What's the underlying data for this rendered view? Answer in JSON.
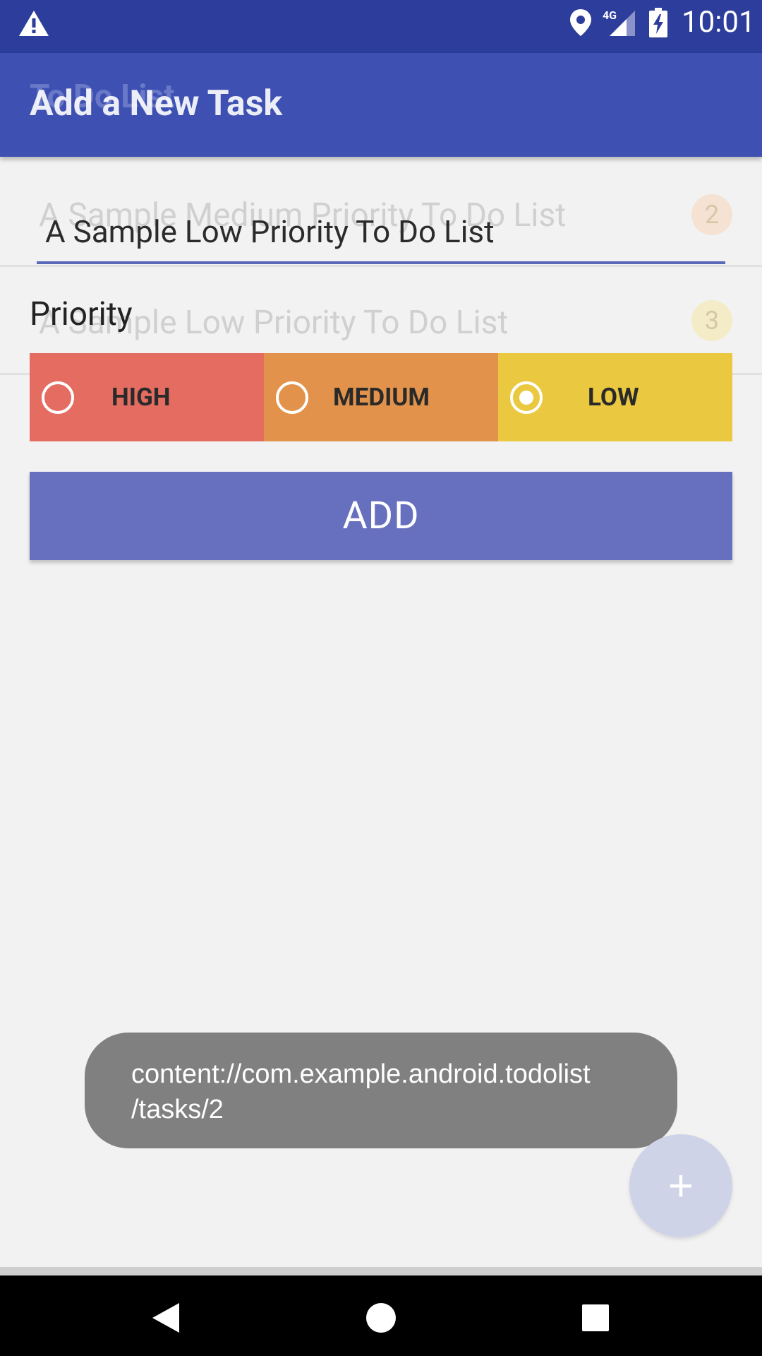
{
  "status_bar": {
    "network": "4G",
    "time": "10:01",
    "icons": [
      "warning-icon",
      "location-icon",
      "signal-icon",
      "battery-charging-icon"
    ]
  },
  "background_screen": {
    "title": "To Do List",
    "rows": [
      {
        "text": "A Sample Medium Priority To Do List",
        "badge": "2"
      },
      {
        "text": "A Sample Low Priority To Do List",
        "badge": "3"
      }
    ]
  },
  "app_bar": {
    "title": "Add a New Task"
  },
  "form": {
    "task_input_value": "A Sample Low Priority To Do List",
    "priority_label": "Priority",
    "priorities": [
      {
        "label": "HIGH",
        "color": "#e56c60",
        "selected": false
      },
      {
        "label": "MEDIUM",
        "color": "#e2924a",
        "selected": false
      },
      {
        "label": "LOW",
        "color": "#eac83f",
        "selected": true
      }
    ],
    "add_button_label": "ADD"
  },
  "toast": {
    "line1": "content://com.example.android.todolist",
    "line2": "/tasks/2"
  },
  "fab": {
    "icon": "plus-icon",
    "label": "+"
  },
  "nav_bar": {
    "icons": [
      "back-icon",
      "home-icon",
      "recents-icon"
    ]
  }
}
